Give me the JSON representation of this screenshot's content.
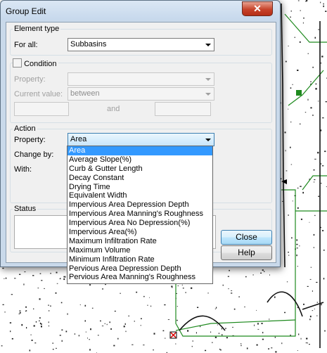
{
  "window": {
    "title": "Group Edit",
    "close_glyph": "✕"
  },
  "element_type": {
    "label": "Element type",
    "for_all_label": "For all:",
    "for_all_value": "Subbasins"
  },
  "condition": {
    "label": "Condition",
    "checked": false,
    "property_label": "Property:",
    "property_value": "",
    "current_value_label": "Current value:",
    "current_value_value": "between",
    "and_label": "and"
  },
  "action": {
    "label": "Action",
    "property_label": "Property:",
    "property_value": "Area",
    "change_by_label": "Change by:",
    "with_label": "With:",
    "options": [
      "Area",
      "Average Slope(%)",
      "Curb & Gutter Length",
      "Decay Constant",
      "Drying Time",
      "Equivalent Width",
      "Impervious Area Depression Depth",
      "Impervious Area Manning's Roughness",
      "Impervious Area No Depression(%)",
      "Impervious Area(%)",
      "Maximum Infiltration Rate",
      "Maximum Volume",
      "Minimum Infiltration Rate",
      "Pervious Area Depression Depth",
      "Pervious Area Manning's Roughness"
    ],
    "selected_index": 0
  },
  "status": {
    "label": "Status"
  },
  "buttons": {
    "close_label": "Close",
    "help_label": "Help"
  },
  "colors": {
    "selection": "#3399ff",
    "map_line": "#1f8a1f",
    "map_ink": "#222222"
  }
}
